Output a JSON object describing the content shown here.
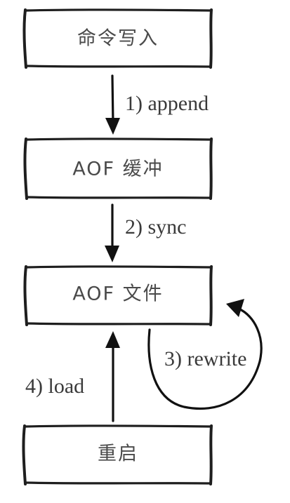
{
  "nodes": {
    "command_write": "命令写入",
    "aof_buffer": "AOF 缓冲",
    "aof_file": "AOF 文件",
    "restart": "重启"
  },
  "edges": {
    "append": "1) append",
    "sync": "2) sync",
    "rewrite": "3) rewrite",
    "load": "4) load"
  }
}
